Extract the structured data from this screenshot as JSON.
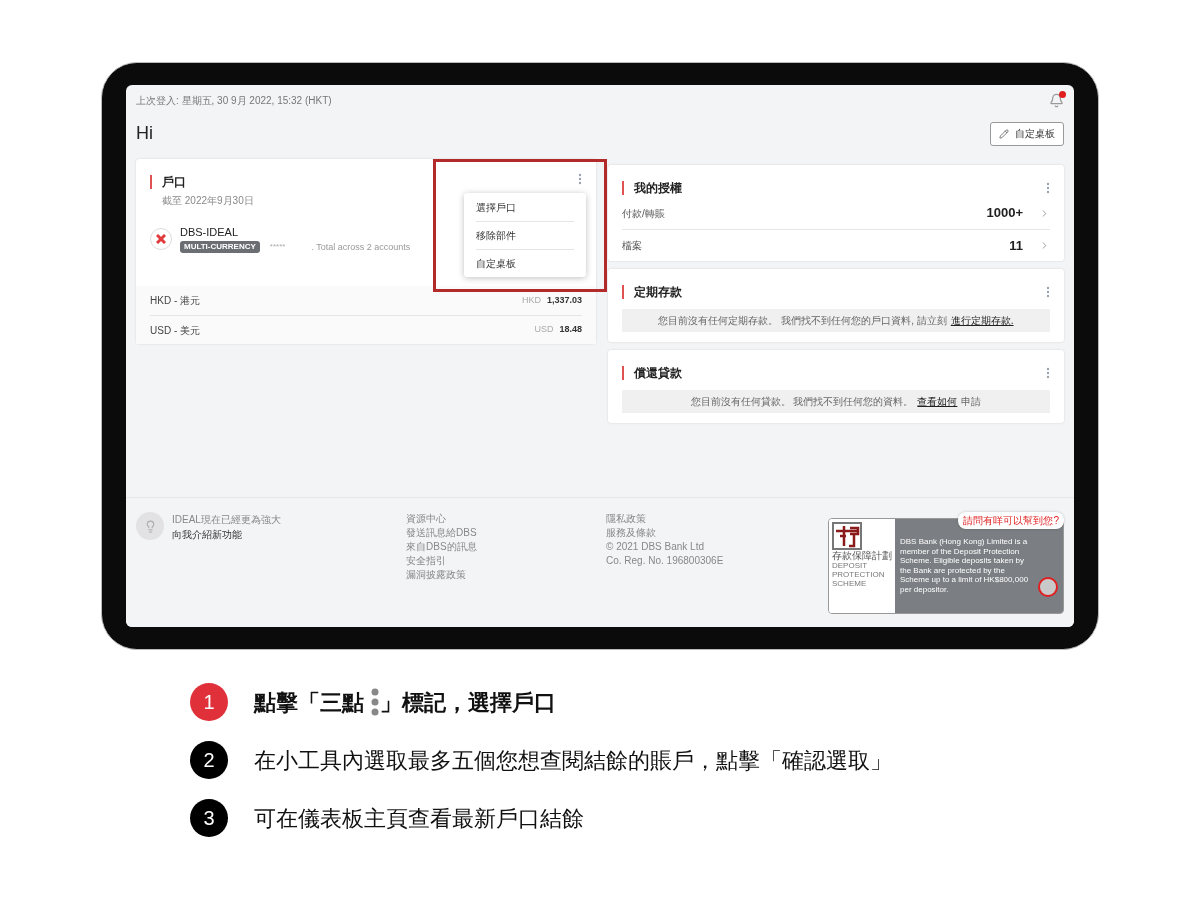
{
  "header": {
    "last_login": "上次登入: 星期五, 30 9月 2022, 15:32 (HKT)",
    "notification_dot": true
  },
  "greeting": "Hi",
  "customize_button": "自定桌板",
  "accounts_card": {
    "title": "戶口",
    "as_of": "截至 2022年9月30日",
    "account_name": "DBS-IDEAL",
    "tag": "MULTI-CURRENCY",
    "masked_balance": "*****",
    "total_note": ". Total across 2 accounts",
    "menu": [
      {
        "label": "選擇戶口"
      },
      {
        "label": "移除部件"
      },
      {
        "label": "自定桌板"
      }
    ],
    "balances": [
      {
        "currency_name": "HKD - 港元",
        "currency": "HKD",
        "amount": "1,337.03"
      },
      {
        "currency_name": "USD - 美元",
        "currency": "USD",
        "amount": "18.48"
      }
    ]
  },
  "authorization_card": {
    "title": "我的授權",
    "rows": [
      {
        "label": "付款/轉賬",
        "value": "1000+"
      },
      {
        "label": "檔案",
        "value": "11"
      }
    ]
  },
  "deposit_card": {
    "title": "定期存款",
    "notice": "您目前沒有任何定期存款。 我們找不到任何您的戶口資料, 請立刻",
    "link": "進行定期存款."
  },
  "loan_card": {
    "title": "償還貸款",
    "notice": "您目前沒有任何貸款。 我們找不到任何您的資料。",
    "link": "查看如何",
    "notice_end": "申請"
  },
  "footer": {
    "tip_title": "IDEAL現在已經更為強大",
    "tip_link": "向我介紹新功能",
    "links_1": [
      "資源中心",
      "發送訊息給DBS",
      "來自DBS的訊息",
      "安全指引",
      "漏洞披露政策"
    ],
    "links_2": [
      "隱私政策",
      "服務及條款",
      "© 2021 DBS Bank Ltd",
      "Co. Reg. No. 196800306E"
    ],
    "badge": {
      "name_zh": "存款保障計劃",
      "name_en": [
        "DEPOSIT",
        "PROTECTION",
        "SCHEME"
      ],
      "note": "DBS Bank (Hong Kong) Limited is a member of the Deposit Protection Scheme. Eligible deposits taken by the Bank are protected by the Scheme up to a limit of HK$800,000 per depositor."
    },
    "chat_bubble": "請問有咩可以幫到您?"
  },
  "steps": [
    {
      "number": "1",
      "active": true,
      "text": "點擊「三點",
      "text_after_icon": "」標記，選擇戶口"
    },
    {
      "number": "2",
      "active": false,
      "text": "在小工具內選取最多五個您想查閱結餘的賬戶，點擊「確認選取」"
    },
    {
      "number": "3",
      "active": false,
      "text": "可在儀表板主頁查看最新戶口結餘"
    }
  ]
}
